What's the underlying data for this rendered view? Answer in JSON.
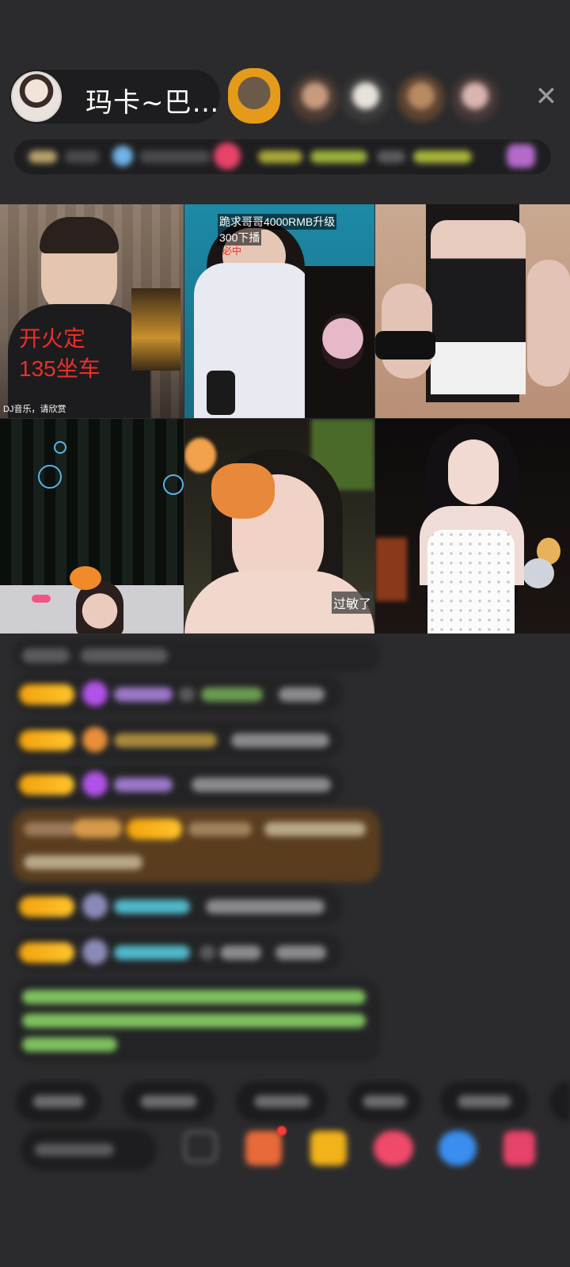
{
  "host": {
    "name": "玛卡~巴…"
  },
  "close_icon_glyph": "✕",
  "video_tiles": [
    {
      "id": "tile-1",
      "overlay_text": "开火定",
      "overlay_text_2": "135坐车",
      "caption": "DJ音乐，请欣赏"
    },
    {
      "id": "tile-2",
      "overlay_text": "跪求哥哥4000RMB升级",
      "overlay_text_2": "300下播",
      "overlay_text_3": "必中"
    },
    {
      "id": "tile-3"
    },
    {
      "id": "tile-4"
    },
    {
      "id": "tile-5",
      "overlay_text": "过敏了"
    },
    {
      "id": "tile-6"
    }
  ],
  "colors": {
    "background": "#2b2b2d",
    "badge_gold": "#f3a20c",
    "highlight_brown": "#5a3d1f",
    "red_overlay_text": "#e8302a",
    "green_chat": "#8bd16a",
    "cyan_name": "#4fb7c9",
    "purple_name": "#b38ee8"
  },
  "icons": {
    "close": "close-icon",
    "gift": "gift-icon",
    "red_packet": "red-packet-icon",
    "gem": "gem-icon",
    "game": "game-icon",
    "chat": "chat-icon",
    "more": "more-icon"
  }
}
